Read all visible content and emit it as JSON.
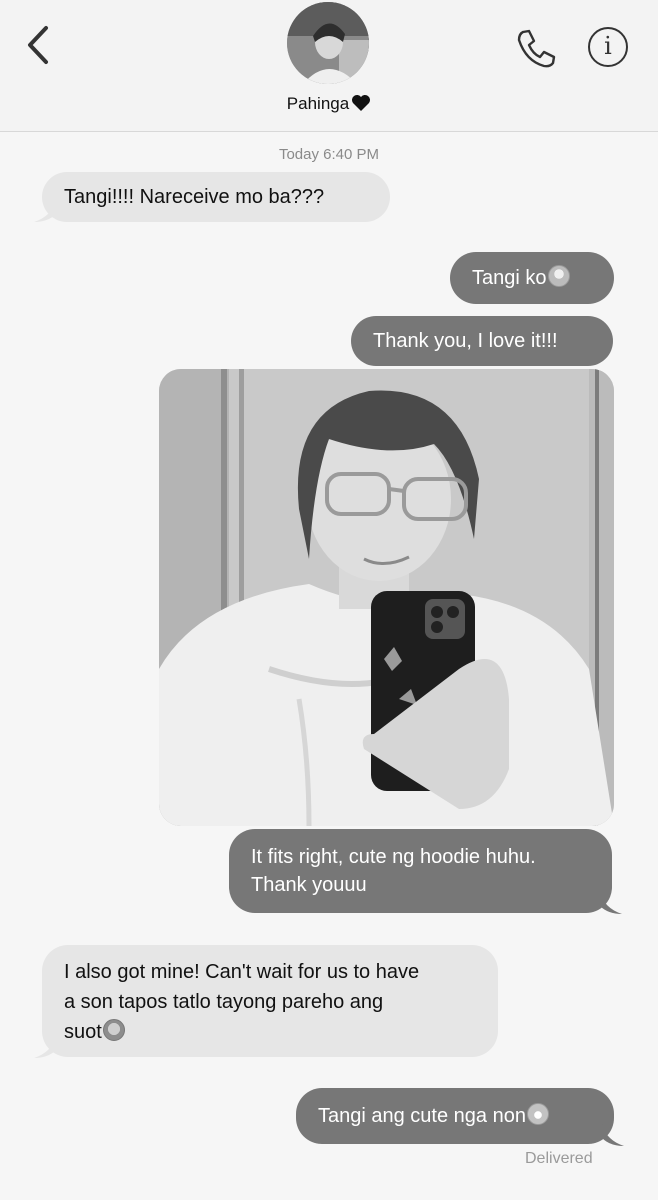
{
  "header": {
    "contact_name": "Pahinga",
    "contact_emoji": "black-heart-icon"
  },
  "timestamp": "Today 6:40 PM",
  "messages": [
    {
      "direction": "incoming",
      "text": "Tangi!!!! Nareceive mo ba???"
    },
    {
      "direction": "outgoing",
      "text": "Tangi ko",
      "emoji": "loudly-crying-face-icon"
    },
    {
      "direction": "outgoing",
      "text": "Thank you, I love it!!!"
    },
    {
      "direction": "outgoing",
      "type": "photo",
      "description_icon": "selfie-photo"
    },
    {
      "direction": "outgoing",
      "line1": "It fits right, cute ng hoodie huhu.",
      "line2": "Thank youuu"
    },
    {
      "direction": "incoming",
      "line1": "I also got mine! Can't wait for us to have",
      "line2": "a son tapos tatlo tayong pareho ang",
      "line3": "suot",
      "emoji": "weary-face-icon"
    },
    {
      "direction": "outgoing",
      "text": "Tangi ang cute nga non",
      "emoji": "grinning-squinting-face-icon"
    }
  ],
  "status": "Delivered",
  "colors": {
    "incoming_bubble": "#e6e6e6",
    "outgoing_bubble": "#777777",
    "background": "#f6f6f6"
  }
}
